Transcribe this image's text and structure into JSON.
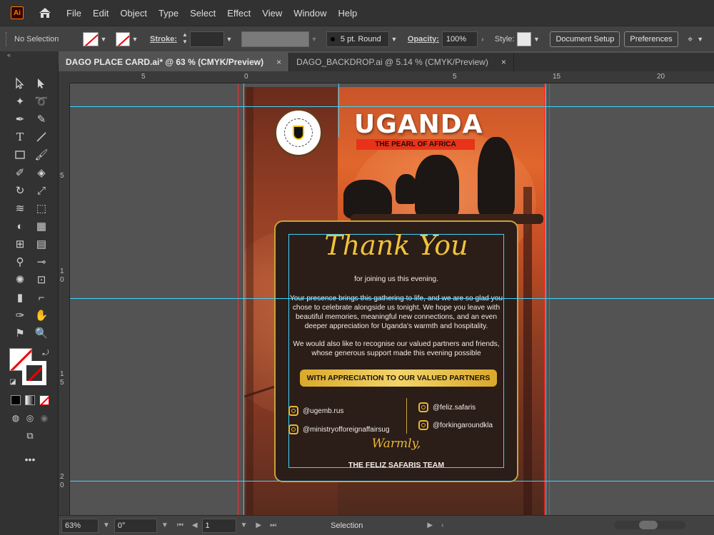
{
  "app": {
    "logo": "Ai",
    "colors": {
      "accent": "#ff7c00",
      "guide": "#3fd3ff",
      "bleed": "#ff2d2d",
      "gold": "#e8b733"
    }
  },
  "menu": [
    "File",
    "Edit",
    "Object",
    "Type",
    "Select",
    "Effect",
    "View",
    "Window",
    "Help"
  ],
  "control": {
    "selection": "No Selection",
    "stroke_label": "Stroke:",
    "brush": "5 pt. Round",
    "opacity_label": "Opacity:",
    "opacity_value": "100%",
    "style_label": "Style:",
    "document_setup": "Document Setup",
    "preferences": "Preferences"
  },
  "tabs": [
    {
      "label": "DAGO PLACE CARD.ai* @ 63 % (CMYK/Preview)",
      "close": "×"
    },
    {
      "label": "DAGO_BACKDROP.ai @ 5.14 % (CMYK/Preview)",
      "close": "×"
    }
  ],
  "ruler": {
    "h": [
      "5",
      "0",
      "5",
      "15",
      "20"
    ],
    "v": [
      "5",
      "1",
      "0",
      "1",
      "5",
      "2",
      "0"
    ]
  },
  "artboard": {
    "title": "UGANDA",
    "subtitle": "THE PEARL OF AFRICA",
    "thank_you": "Thank You",
    "line1": "for joining us this evening.",
    "para1": "Your presence brings this gathering to life, and we are so glad you chose to celebrate alongside us tonight. We hope you leave with beautiful memories, meaningful new connections, and an even deeper appreciation for Uganda's warmth and hospitality.",
    "para2": "We would also like to recognise our valued partners and friends, whose generous support made this evening possible",
    "appreciation": "WITH APPRECIATION TO OUR VALUED PARTNERS",
    "socials_left": [
      "@ugemb.rus",
      "@ministryofforeignaffairsug"
    ],
    "socials_right": [
      "@feliz.safaris",
      "@forkingaroundkla"
    ],
    "warmly": "Warmly,",
    "team": "THE FELIZ SAFARIS TEAM"
  },
  "status": {
    "zoom": "63%",
    "rotation": "0°",
    "artboard": "1",
    "mode": "Selection"
  }
}
